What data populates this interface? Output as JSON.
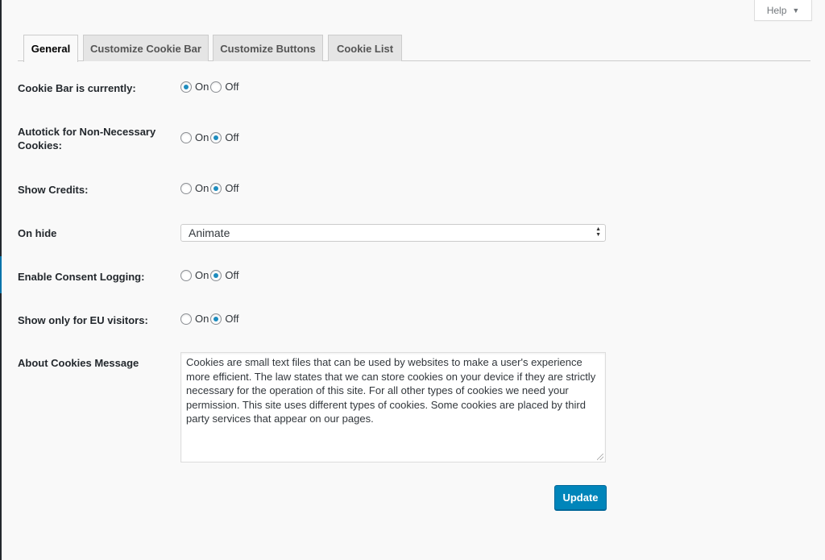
{
  "help": {
    "label": "Help",
    "icon": "caret-down-icon"
  },
  "tabs": [
    {
      "label": "General",
      "active": true
    },
    {
      "label": "Customize Cookie Bar",
      "active": false
    },
    {
      "label": "Customize Buttons",
      "active": false
    },
    {
      "label": "Cookie List",
      "active": false
    }
  ],
  "settings": {
    "cookie_bar": {
      "label": "Cookie Bar is currently:",
      "on_label": "On",
      "off_label": "Off",
      "value": "On"
    },
    "autotick": {
      "label_line1": "Autotick for Non-Necessary",
      "label_line2": "Cookies:",
      "on_label": "On",
      "off_label": "Off",
      "value": "Off"
    },
    "show_credits": {
      "label": "Show Credits:",
      "on_label": "On",
      "off_label": "Off",
      "value": "Off"
    },
    "on_hide": {
      "label": "On hide",
      "selected": "Animate"
    },
    "consent_logging": {
      "label": "Enable Consent Logging:",
      "on_label": "On",
      "off_label": "Off",
      "value": "Off"
    },
    "eu_only": {
      "label": "Show only for EU visitors:",
      "on_label": "On",
      "off_label": "Off",
      "value": "Off"
    },
    "about_message": {
      "label": "About Cookies Message",
      "value": "Cookies are small text files that can be used by websites to make a user's experience more efficient. The law states that we can store cookies on your device if they are strictly necessary for the operation of this site. For all other types of cookies we need your permission. This site uses different types of cookies. Some cookies are placed by third party services that appear on our pages."
    }
  },
  "update_button": {
    "label": "Update"
  },
  "colors": {
    "accent": "#0085ba",
    "radio_checked": "#1e8cbe"
  }
}
